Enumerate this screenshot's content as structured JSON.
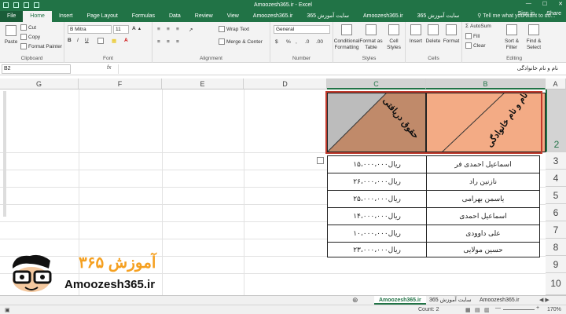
{
  "titlebar": {
    "title": "Amoozesh365.ir - Excel"
  },
  "tabs": [
    {
      "label": "File"
    },
    {
      "label": "Home"
    },
    {
      "label": "Insert"
    },
    {
      "label": "Page Layout"
    },
    {
      "label": "Formulas"
    },
    {
      "label": "Data"
    },
    {
      "label": "Review"
    },
    {
      "label": "View"
    },
    {
      "label": "Amoozesh365.ir"
    },
    {
      "label": "سایت آموزش 365"
    },
    {
      "label": "Amoozesh365.ir"
    },
    {
      "label": "سایت آموزش 365"
    }
  ],
  "tellme": "Tell me what you want to do...",
  "signin": "Sign in",
  "share": "Share",
  "ribbon": {
    "clipboard": {
      "paste": "Paste",
      "cut": "Cut",
      "copy": "Copy",
      "format_painter": "Format Painter",
      "label": "Clipboard"
    },
    "font": {
      "name": "B Mitra",
      "size": "11",
      "label": "Font"
    },
    "alignment": {
      "wrap": "Wrap Text",
      "merge": "Merge & Center",
      "label": "Alignment"
    },
    "number": {
      "format": "General",
      "label": "Number"
    },
    "styles": {
      "cond": "Conditional Formatting",
      "table": "Format as Table",
      "cell": "Cell Styles",
      "label": "Styles"
    },
    "cells": {
      "insert": "Insert",
      "delete": "Delete",
      "format": "Format",
      "label": "Cells"
    },
    "editing": {
      "autosum": "AutoSum",
      "fill": "Fill",
      "clear": "Clear",
      "sort": "Sort & Filter",
      "find": "Find & Select",
      "label": "Editing"
    }
  },
  "formula": {
    "namebox": "B2",
    "fx": "fx",
    "content": "نام و نام خانوادگی"
  },
  "columns": [
    "G",
    "F",
    "E",
    "D",
    "C",
    "B",
    "A"
  ],
  "rows": [
    "2",
    "3",
    "4",
    "5",
    "6",
    "7",
    "8",
    "9",
    "10"
  ],
  "table": {
    "header_name": "نام و نام خانوادگی",
    "header_salary": "حقوق دریافتی",
    "records": [
      {
        "name": "اسماعیل احمدی فر",
        "salary": "۱۵،۰۰۰،۰۰۰ریال"
      },
      {
        "name": "نازنین راد",
        "salary": "۲۶،۰۰۰،۰۰۰ریال"
      },
      {
        "name": "یاسمن بهرامی",
        "salary": "۲۵،۰۰۰،۰۰۰ریال"
      },
      {
        "name": "اسماعیل احمدی",
        "salary": "۱۴،۰۰۰،۰۰۰ریال"
      },
      {
        "name": "علی داوودی",
        "salary": "۱۰،۰۰۰،۰۰۰ریال"
      },
      {
        "name": "حسین مولایی",
        "salary": "۲۳،۰۰۰،۰۰۰ریال"
      }
    ]
  },
  "sheets": [
    "Amoozesh365.ir",
    "سایت آموزش 365",
    "Amoozesh365.ir"
  ],
  "status": {
    "count": "Count: 2",
    "zoom": "170%"
  },
  "logo": {
    "brand": "آموزش ۳۶۵",
    "site": "Amoozesh365.ir"
  },
  "colors": {
    "excel_green": "#217346",
    "header_b": "#f3ab85",
    "header_c": "#c08a6a",
    "header_c_gray": "#bcbcbc",
    "selection_red": "#c0392b"
  }
}
